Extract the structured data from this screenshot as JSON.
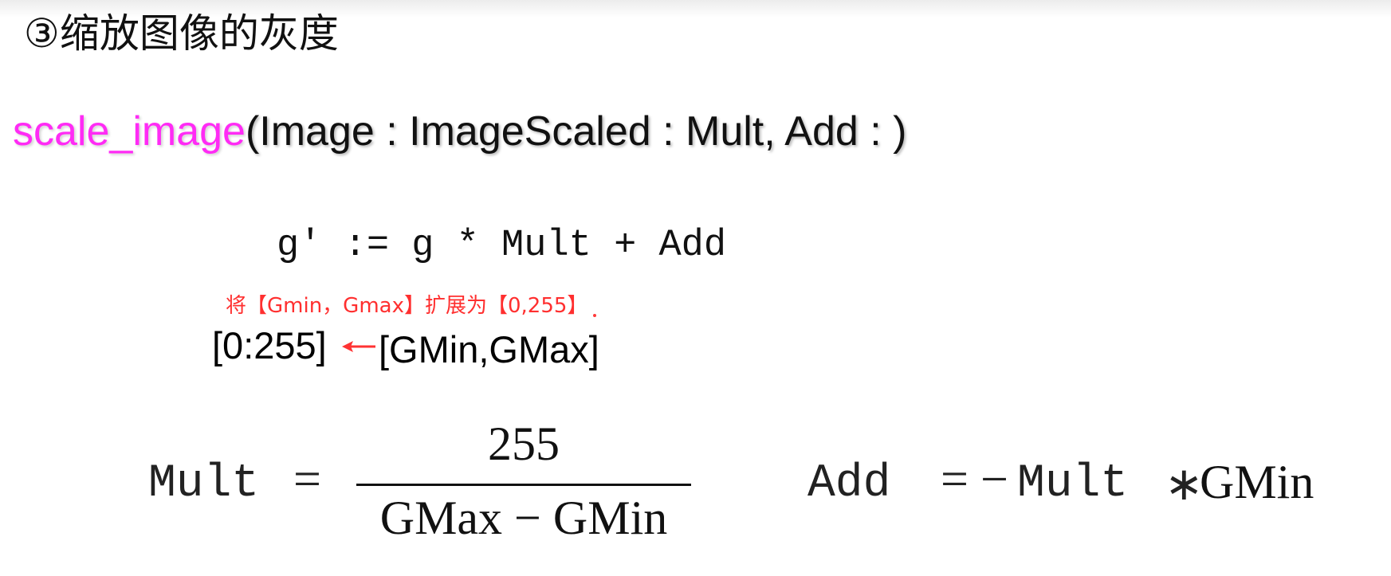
{
  "heading": "③缩放图像的灰度",
  "signature": {
    "function_name": "scale_image",
    "params": "(Image : ImageScaled : Mult, Add : )"
  },
  "formula_line": "g' := g * Mult + Add",
  "annotation": "将【Gmin，Gmax】扩展为【0,255】",
  "mapping": {
    "target": "[0:255]",
    "source": "[GMin,GMax]"
  },
  "mult_formula": {
    "lhs": "Mult",
    "equals": "=",
    "numerator": "255",
    "denominator": "GMax − GMin"
  },
  "add_formula": {
    "lhs": "Add",
    "equals": "=",
    "negative": "−",
    "mult": "Mult",
    "operator": "∗",
    "gmin": "GMin"
  },
  "colors": {
    "function_name": "#ff2bf5",
    "annotation": "#ff2f2f",
    "arrow": "#ff3333"
  }
}
